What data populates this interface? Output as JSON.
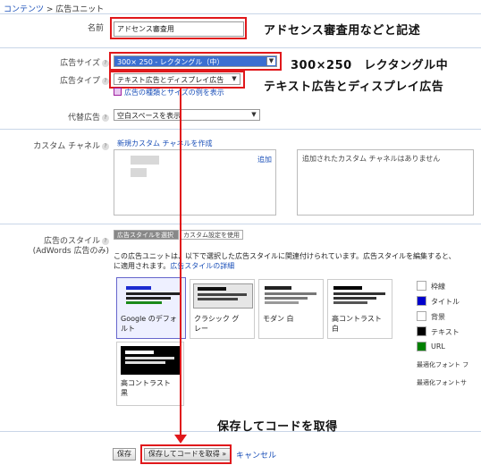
{
  "breadcrumb": {
    "root": "コンテンツ",
    "separator": " > ",
    "current": "広告ユニット"
  },
  "form": {
    "name_label": "名前",
    "name_value": "アドセンス審査用",
    "size_label": "広告サイズ",
    "size_value": "300× 250 - レクタングル（中）",
    "type_label": "広告タイプ",
    "type_value": "テキスト広告とディスプレイ広告",
    "type_link": "広告の種類とサイズの例を表示",
    "fallback_label": "代替広告",
    "fallback_value": "空白スペースを表示",
    "channel_label": "カスタム チャネル",
    "channel_create_link": "新規カスタム チャネルを作成",
    "channel_add_link": "追加",
    "channel_empty_text": "追加されたカスタム チャネルはありません",
    "style_label": "広告のスタイル",
    "style_sublabel": "(AdWords 広告のみ)",
    "style_tab_select": "広告スタイルを選択",
    "style_tab_custom": "カスタム設定を使用",
    "style_description": "この広告ユニットは、以下で選択した広告スタイルに関連付けられています。広告スタイルを編集すると、この広告スタイルを使用しているすべての広告ユニットに適用されます。",
    "style_desc_prefix_1": "この広告ユニットは、以下で選択した広告スタイルに関連付けられています。広告スタイルを編集すると、",
    "style_desc_prefix_2": "に適用されます。",
    "style_detail_link": "広告スタイルの詳細"
  },
  "style_cards": [
    {
      "label_1": "Google のデフォ",
      "label_2": "ルト"
    },
    {
      "label_1": "クラシック グ",
      "label_2": "レー"
    },
    {
      "label_1": "モダン 白",
      "label_2": ""
    },
    {
      "label_1": "高コントラスト",
      "label_2": "白"
    },
    {
      "label_1": "高コントラスト",
      "label_2": "黒"
    }
  ],
  "legend": {
    "border": "枠線",
    "title": "タイトル",
    "background": "背景",
    "text": "テキスト",
    "url": "URL",
    "font1": "最適化フォント フ",
    "font2": "最適化フォントサ"
  },
  "colors": {
    "border": "#ffffff",
    "title": "#0000cc",
    "background": "#ffffff",
    "text": "#000000",
    "url": "#008000",
    "annotation_red": "#e0181b"
  },
  "buttons": {
    "save": "保存",
    "save_get_code": "保存してコードを取得 »",
    "cancel": "キャンセル"
  },
  "annotations": {
    "name": "アドセンス審査用などと記述",
    "size": "300×250　レクタングル中",
    "type": "テキスト広告とディスプレイ広告",
    "save": "保存してコードを取得"
  }
}
